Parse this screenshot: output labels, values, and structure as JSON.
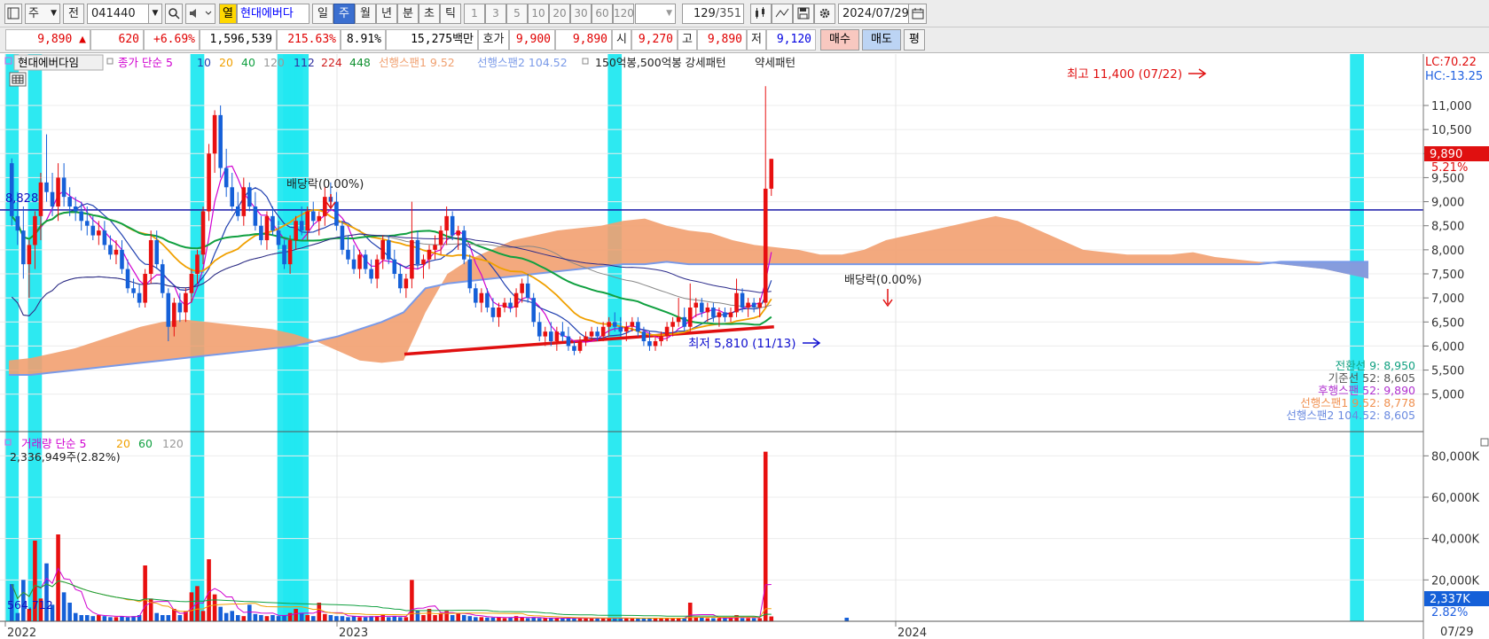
{
  "toolbar": {
    "period_type": "주",
    "prev_label": "전",
    "stock_code": "041440",
    "favorite_label": "열",
    "stock_name": "현대에버다",
    "period_tabs": [
      "일",
      "주",
      "월",
      "년",
      "분",
      "초",
      "틱"
    ],
    "active_period": "주",
    "intervals": [
      "1",
      "3",
      "5",
      "10",
      "20",
      "30",
      "60",
      "120"
    ],
    "page_count": "129",
    "page_total": "/351",
    "date": "2024/07/29"
  },
  "quote": {
    "price": "9,890 ▲",
    "change": "620",
    "change_pct": "+6.69%",
    "volume": "1,596,539",
    "volume_ratio": "215.63%",
    "turnover": "8.91%",
    "amount": "15,275백만",
    "bid_label": "호가",
    "ask_price": "9,900",
    "bid_price": "9,890",
    "open_label": "시",
    "open": "9,270",
    "high_label": "고",
    "high": "9,890",
    "low_label": "저",
    "low": "9,120",
    "buy_label": "매수",
    "sell_label": "매도",
    "avg_label": "평"
  },
  "price_panel": {
    "legend": {
      "name": "현대에버다임",
      "ma_label": "종가 단순",
      "ma_periods": [
        "5",
        "10",
        "20",
        "40",
        "120",
        "112",
        "224",
        "448"
      ],
      "span1_label": "선행스팬1 9.52",
      "span2_label": "선행스팬2 104.52",
      "pattern_label": "150억봉,500억봉 강세패턴",
      "weak_label": "약세패턴"
    },
    "lc": "LC:70.22",
    "hc": "HC:-13.25",
    "current_tag": "9,890",
    "current_pct": "5.21%",
    "left_level": "8,828",
    "high_annot": "최고 11,400 (07/22)",
    "low_annot": "최저 5,810 (11/13)",
    "dividend1": "배당락(0.00%)",
    "dividend2": "배당락(0.00%)",
    "ichimoku": [
      "전환선 9: 8,950",
      "기준선 52: 8,605",
      "후행스팬 52: 9,890",
      "선행스팬1 9.52: 8,778",
      "선행스팬2 104.52: 8,605"
    ]
  },
  "volume_panel": {
    "title": "거래량",
    "ma_label": "단순",
    "ma_periods": [
      "5",
      "20",
      "60",
      "120"
    ],
    "current_text": "2,336,949주(2.82%)",
    "avg_text": "564,712",
    "current_tag": "2,337K",
    "current_pct": "2.82%"
  },
  "x_labels": [
    "2022",
    "2023",
    "2024"
  ],
  "x_current": "07/29",
  "colors": {
    "up": "#e81010",
    "down": "#1560d8",
    "ma5": "#d000d0",
    "ma10": "#2040b0",
    "ma20": "#f0a000",
    "ma40": "#10a040",
    "cloud": "#f2a070",
    "cloud_down": "#7a9ae8",
    "highlight": "#22e8f0",
    "support": "#e01010"
  },
  "chart_data": {
    "type": "candlestick",
    "price_axis": {
      "ticks": [
        5000,
        5500,
        6000,
        6500,
        7000,
        7500,
        8000,
        8500,
        9000,
        9500,
        10000,
        10500,
        11000
      ],
      "tick_labels": [
        "5,000",
        "5,500",
        "6,000",
        "6,500",
        "7,000",
        "7,500",
        "8,000",
        "8,500",
        "9,000",
        "9,500",
        "10,000",
        "10,500",
        "11,000"
      ],
      "ylim": [
        4700,
        11700
      ]
    },
    "volume_axis": {
      "tick_labels": [
        "20,000K",
        "40,000K",
        "60,000K",
        "80,000K"
      ],
      "ticks": [
        20000,
        40000,
        60000,
        80000
      ],
      "ylim": [
        0,
        90000
      ]
    },
    "start_week": "2022-01-03",
    "highlight_weeks": [
      0,
      4,
      32,
      47,
      48,
      49,
      50,
      104,
      232
    ],
    "candles": [
      [
        9800,
        9900,
        8500,
        8700
      ],
      [
        8700,
        9200,
        8100,
        8400
      ],
      [
        8400,
        8900,
        7400,
        7700
      ],
      [
        7700,
        8200,
        7000,
        8100
      ],
      [
        8100,
        8800,
        7600,
        8700
      ],
      [
        8700,
        9600,
        8200,
        9400
      ],
      [
        9400,
        10400,
        9000,
        9200
      ],
      [
        9200,
        9600,
        8700,
        8900
      ],
      [
        8900,
        9800,
        8600,
        9500
      ],
      [
        9500,
        9800,
        8900,
        9100
      ],
      [
        9100,
        9300,
        8700,
        8900
      ],
      [
        8900,
        9100,
        8600,
        8800
      ],
      [
        8800,
        9000,
        8400,
        8600
      ],
      [
        8600,
        8900,
        8300,
        8500
      ],
      [
        8500,
        8700,
        8200,
        8300
      ],
      [
        8300,
        8600,
        8100,
        8400
      ],
      [
        8400,
        8600,
        8000,
        8100
      ],
      [
        8100,
        8300,
        7800,
        7900
      ],
      [
        7900,
        8200,
        7700,
        8000
      ],
      [
        8000,
        8200,
        7500,
        7600
      ],
      [
        7600,
        7800,
        7100,
        7200
      ],
      [
        7200,
        7400,
        7000,
        7100
      ],
      [
        7100,
        7300,
        6800,
        6900
      ],
      [
        6900,
        7600,
        6800,
        7500
      ],
      [
        7500,
        8400,
        7300,
        8200
      ],
      [
        8200,
        8400,
        7600,
        7700
      ],
      [
        7700,
        7800,
        7000,
        7100
      ],
      [
        7100,
        7200,
        6100,
        6400
      ],
      [
        6400,
        7000,
        6200,
        6900
      ],
      [
        6900,
        7100,
        6500,
        6700
      ],
      [
        6700,
        7200,
        6500,
        7100
      ],
      [
        7100,
        7600,
        6900,
        7500
      ],
      [
        7500,
        8000,
        7300,
        7900
      ],
      [
        7900,
        8900,
        7700,
        8800
      ],
      [
        8800,
        10200,
        8600,
        10000
      ],
      [
        10000,
        10900,
        9600,
        10800
      ],
      [
        10800,
        11000,
        9500,
        9700
      ],
      [
        9700,
        10100,
        9100,
        9300
      ],
      [
        9300,
        9600,
        8800,
        8900
      ],
      [
        8900,
        9200,
        8600,
        8700
      ],
      [
        8700,
        9500,
        8500,
        9300
      ],
      [
        9300,
        9400,
        8800,
        8900
      ],
      [
        8900,
        9200,
        8400,
        8500
      ],
      [
        8500,
        8700,
        8100,
        8200
      ],
      [
        8200,
        8800,
        8000,
        8700
      ],
      [
        8700,
        8900,
        8300,
        8400
      ],
      [
        8400,
        8600,
        8000,
        8100
      ],
      [
        8100,
        8200,
        7600,
        7700
      ],
      [
        7700,
        8300,
        7500,
        8200
      ],
      [
        8200,
        8700,
        8000,
        8600
      ],
      [
        8600,
        8900,
        8300,
        8400
      ],
      [
        8400,
        8900,
        8200,
        8800
      ],
      [
        8800,
        9000,
        8500,
        8600
      ],
      [
        8600,
        8800,
        8300,
        8700
      ],
      [
        8700,
        9300,
        8500,
        9100
      ],
      [
        9100,
        9400,
        8800,
        9000
      ],
      [
        9000,
        9200,
        8400,
        8500
      ],
      [
        8500,
        8600,
        7900,
        8000
      ],
      [
        8000,
        8300,
        7700,
        7800
      ],
      [
        7800,
        8100,
        7500,
        7600
      ],
      [
        7600,
        8000,
        7400,
        7900
      ],
      [
        7900,
        8000,
        7500,
        7600
      ],
      [
        7600,
        7800,
        7300,
        7400
      ],
      [
        7400,
        7900,
        7200,
        7800
      ],
      [
        7800,
        8300,
        7600,
        8200
      ],
      [
        8200,
        8300,
        7700,
        7800
      ],
      [
        7800,
        8000,
        7400,
        7500
      ],
      [
        7500,
        7700,
        7100,
        7200
      ],
      [
        7200,
        7500,
        7000,
        7400
      ],
      [
        7400,
        9000,
        7200,
        8200
      ],
      [
        8200,
        8400,
        7600,
        7700
      ],
      [
        7700,
        7900,
        7400,
        7800
      ],
      [
        7800,
        8100,
        7600,
        8000
      ],
      [
        8000,
        8300,
        7800,
        8100
      ],
      [
        8100,
        8500,
        7900,
        8400
      ],
      [
        8400,
        8900,
        8100,
        8700
      ],
      [
        8700,
        8800,
        8200,
        8300
      ],
      [
        8300,
        8500,
        8000,
        8400
      ],
      [
        8400,
        8500,
        7700,
        7800
      ],
      [
        7800,
        7900,
        7100,
        7200
      ],
      [
        7200,
        7300,
        6800,
        6900
      ],
      [
        6900,
        7200,
        6700,
        7100
      ],
      [
        7100,
        7200,
        6700,
        6800
      ],
      [
        6800,
        7000,
        6500,
        6600
      ],
      [
        6600,
        6900,
        6400,
        6800
      ],
      [
        6800,
        7000,
        6700,
        6900
      ],
      [
        6900,
        7000,
        6700,
        6800
      ],
      [
        6800,
        7200,
        6600,
        7100
      ],
      [
        7100,
        7400,
        6900,
        7300
      ],
      [
        7300,
        7500,
        6900,
        7000
      ],
      [
        7000,
        7100,
        6400,
        6500
      ],
      [
        6500,
        6700,
        6100,
        6200
      ],
      [
        6200,
        6400,
        6000,
        6300
      ],
      [
        6300,
        6500,
        6000,
        6100
      ],
      [
        6100,
        6400,
        5900,
        6300
      ],
      [
        6300,
        6500,
        6100,
        6200
      ],
      [
        6200,
        6400,
        5900,
        6000
      ],
      [
        6000,
        6100,
        5810,
        5900
      ],
      [
        5900,
        6200,
        5850,
        6100
      ],
      [
        6100,
        6300,
        6000,
        6200
      ],
      [
        6200,
        6400,
        6100,
        6300
      ],
      [
        6300,
        6400,
        6100,
        6200
      ],
      [
        6200,
        6500,
        6100,
        6400
      ],
      [
        6400,
        6600,
        6200,
        6500
      ],
      [
        6500,
        6700,
        6300,
        6400
      ],
      [
        6400,
        6600,
        6200,
        6300
      ],
      [
        6300,
        6500,
        6100,
        6400
      ],
      [
        6400,
        6600,
        6300,
        6500
      ],
      [
        6500,
        6600,
        6200,
        6300
      ],
      [
        6300,
        6400,
        6000,
        6100
      ],
      [
        6100,
        6300,
        5900,
        6000
      ],
      [
        6000,
        6200,
        5900,
        6100
      ],
      [
        6100,
        6300,
        6000,
        6200
      ],
      [
        6200,
        6500,
        6100,
        6400
      ],
      [
        6400,
        6600,
        6200,
        6500
      ],
      [
        6500,
        7000,
        6400,
        6600
      ],
      [
        6600,
        6800,
        6300,
        6400
      ],
      [
        6400,
        7300,
        6300,
        6800
      ],
      [
        6800,
        7000,
        6600,
        6900
      ],
      [
        6900,
        7000,
        6600,
        6700
      ],
      [
        6700,
        6900,
        6500,
        6800
      ],
      [
        6800,
        6900,
        6500,
        6600
      ],
      [
        6600,
        6800,
        6400,
        6700
      ],
      [
        6700,
        6800,
        6500,
        6600
      ],
      [
        6600,
        6800,
        6500,
        6700
      ],
      [
        6700,
        7400,
        6600,
        7100
      ],
      [
        7100,
        7200,
        6700,
        6800
      ],
      [
        6800,
        7000,
        6600,
        6900
      ],
      [
        6900,
        7000,
        6700,
        6800
      ],
      [
        6800,
        7000,
        6600,
        6900
      ],
      [
        6900,
        11400,
        6800,
        9270
      ],
      [
        9270,
        9890,
        9120,
        9890
      ]
    ],
    "volumes": [
      18000,
      4000,
      20000,
      6000,
      39000,
      11000,
      28000,
      8000,
      42000,
      14000,
      9000,
      4000,
      3000,
      3000,
      2500,
      3000,
      2500,
      2000,
      2000,
      2500,
      2000,
      2500,
      3000,
      27000,
      11000,
      4000,
      3000,
      3000,
      6000,
      3000,
      5000,
      14000,
      17000,
      5000,
      30000,
      13000,
      7000,
      4000,
      5000,
      3000,
      2500,
      8000,
      3500,
      3000,
      2500,
      3000,
      2500,
      3000,
      4000,
      6000,
      4000,
      3000,
      2500,
      9000,
      3500,
      3000,
      2500,
      2500,
      2000,
      2500,
      2000,
      2000,
      2500,
      2500,
      3000,
      2000,
      2500,
      2000,
      2000,
      20000,
      5000,
      3000,
      6000,
      3000,
      4000,
      5000,
      3000,
      4000,
      3000,
      2500,
      2000,
      2000,
      1800,
      1800,
      2000,
      1500,
      1800,
      2500,
      1800,
      1500,
      1800,
      1500,
      1500,
      1500,
      1500,
      1500,
      1500,
      1500,
      1500,
      1500,
      1500,
      1500,
      1500,
      1500,
      1500,
      1500,
      1500,
      1500,
      1500,
      1500,
      1500,
      1500,
      1500,
      1500,
      1500,
      1500,
      1500,
      9000,
      2000,
      2000,
      1500,
      1500,
      1500,
      1500,
      1500,
      3000,
      1500,
      1500,
      1500,
      1500,
      82000,
      2337
    ],
    "support_line": {
      "x": [
        0.0,
        1.0
      ],
      "y": [
        5830,
        6400
      ]
    },
    "resistance_level": 8828,
    "cloud_upper": [
      5700,
      5750,
      5850,
      5950,
      6100,
      6250,
      6400,
      6500,
      6550,
      6500,
      6450,
      6400,
      6350,
      6250,
      6100,
      5900,
      5700,
      5650,
      5700,
      6700,
      7500,
      7800,
      8000,
      8200,
      8300,
      8400,
      8450,
      8500,
      8600,
      8650,
      8500,
      8400,
      8350,
      8200,
      8100,
      8050,
      8000,
      7900,
      7900,
      8000,
      8200,
      8300,
      8400,
      8500,
      8600,
      8700,
      8600,
      8400,
      8200,
      8000,
      7950,
      7900,
      7900,
      7900,
      7950,
      7850,
      7800,
      7750,
      7700,
      7650,
      7600,
      7500,
      7400
    ],
    "cloud_lower": [
      5400,
      5400,
      5450,
      5500,
      5550,
      5600,
      5650,
      5700,
      5750,
      5800,
      5850,
      5900,
      5950,
      6000,
      6100,
      6200,
      6350,
      6500,
      6700,
      7200,
      7300,
      7350,
      7400,
      7450,
      7500,
      7550,
      7600,
      7650,
      7700,
      7700,
      7750,
      7700,
      7700,
      7700,
      7700,
      7700,
      7700,
      7700,
      7700,
      7700,
      7700,
      7700,
      7700,
      7700,
      7700,
      7700,
      7700,
      7700,
      7700,
      7700,
      7700,
      7700,
      7700,
      7700,
      7700,
      7700,
      7700,
      7700,
      7750,
      7750,
      7750,
      7750,
      7750
    ],
    "series": [
      {
        "name": "5",
        "values": []
      },
      {
        "name": "10",
        "values": []
      },
      {
        "name": "20",
        "values": []
      },
      {
        "name": "40",
        "values": []
      }
    ]
  }
}
